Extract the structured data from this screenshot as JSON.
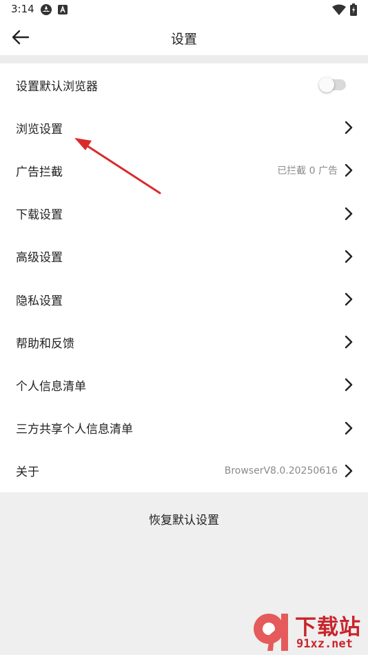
{
  "status_bar": {
    "time": "3:14"
  },
  "header": {
    "title": "设置"
  },
  "settings": {
    "items": [
      {
        "label": "设置默认浏览器",
        "control": "toggle",
        "toggle_on": false
      },
      {
        "label": "浏览设置",
        "control": "chevron"
      },
      {
        "label": "广告拦截",
        "value": "已拦截 0 广告",
        "control": "chevron"
      },
      {
        "label": "下载设置",
        "control": "chevron"
      },
      {
        "label": "高级设置",
        "control": "chevron"
      },
      {
        "label": "隐私设置",
        "control": "chevron"
      },
      {
        "label": "帮助和反馈",
        "control": "chevron"
      },
      {
        "label": "个人信息清单",
        "control": "chevron"
      },
      {
        "label": "三方共享个人信息清单",
        "control": "chevron"
      },
      {
        "label": "关于",
        "value": "BrowserV8.0.20250616",
        "control": "chevron"
      }
    ]
  },
  "footer": {
    "restore_label": "恢复默认设置"
  },
  "watermark": {
    "line1": "下载站",
    "line2": "91xz.net"
  },
  "colors": {
    "annotation": "#d92b2b",
    "watermark": "#c9242b",
    "background": "#efefef"
  }
}
